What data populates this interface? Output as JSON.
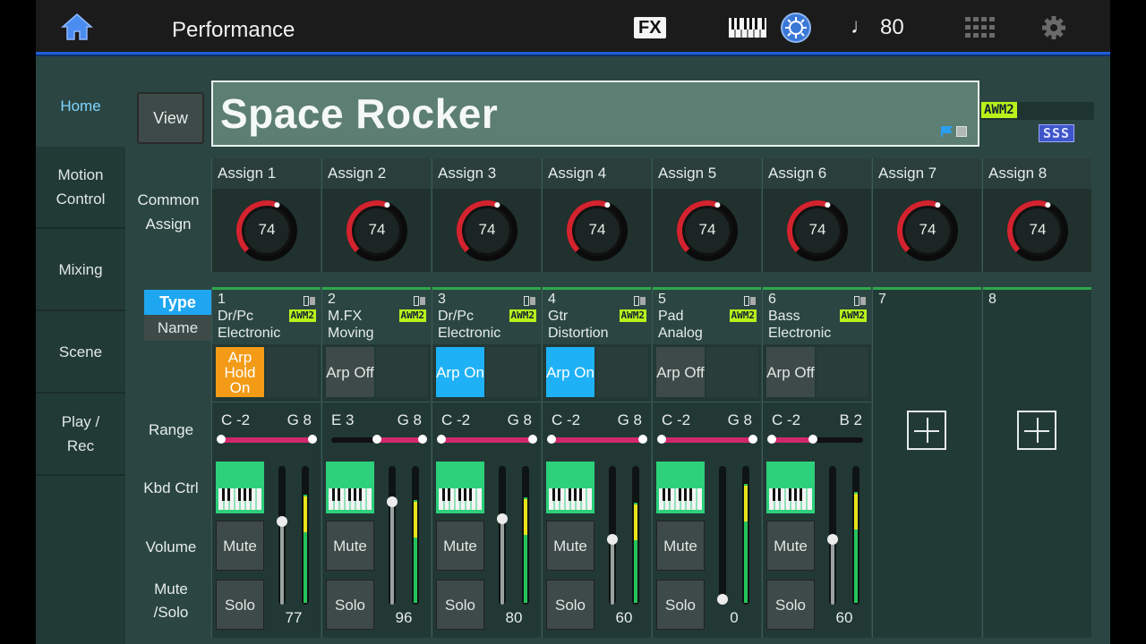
{
  "topbar": {
    "title": "Performance",
    "fx_label": "FX",
    "tempo": "80",
    "tempo_icon": "quarter-note-icon"
  },
  "sidebar": [
    {
      "label": "Home",
      "active": true
    },
    {
      "label": "Motion Control",
      "active": false
    },
    {
      "label": "Mixing",
      "active": false
    },
    {
      "label": "Scene",
      "active": false
    },
    {
      "label": "Play / Rec",
      "active": false
    }
  ],
  "header": {
    "view_label": "View",
    "performance_name": "Space Rocker",
    "awm2": "AWM2",
    "sss": "SSS"
  },
  "common_assign": {
    "label": "Common Assign",
    "knobs": [
      {
        "label": "Assign 1",
        "value": "74",
        "level": 0.58
      },
      {
        "label": "Assign 2",
        "value": "74",
        "level": 0.58
      },
      {
        "label": "Assign 3",
        "value": "74",
        "level": 0.58
      },
      {
        "label": "Assign 4",
        "value": "74",
        "level": 0.58
      },
      {
        "label": "Assign 5",
        "value": "74",
        "level": 0.58
      },
      {
        "label": "Assign 6",
        "value": "74",
        "level": 0.58
      },
      {
        "label": "Assign 7",
        "value": "74",
        "level": 0.58
      },
      {
        "label": "Assign 8",
        "value": "74",
        "level": 0.58
      }
    ]
  },
  "row_labels": {
    "type": "Type",
    "name": "Name",
    "range": "Range",
    "kbd_ctrl": "Kbd Ctrl",
    "volume": "Volume",
    "mute_solo": "Mute /Solo"
  },
  "parts": [
    {
      "num": "1",
      "category": "Dr/Pc",
      "sub": "Electronic",
      "engine": "AWM2",
      "arp": "Arp Hold On",
      "arp_state": "hold",
      "range_lo": "C -2",
      "range_hi": "G 8",
      "range_start": 0.0,
      "range_end": 1.0,
      "mute": "Mute",
      "solo": "Solo",
      "volume": "77",
      "fader_level": 0.61,
      "meter_level": 0.8
    },
    {
      "num": "2",
      "category": "M.FX",
      "sub": "Moving",
      "engine": "AWM2",
      "arp": "Arp Off",
      "arp_state": "off",
      "range_lo": "E 3",
      "range_hi": "G 8",
      "range_start": 0.5,
      "range_end": 1.0,
      "mute": "Mute",
      "solo": "Solo",
      "volume": "96",
      "fader_level": 0.76,
      "meter_level": 0.76
    },
    {
      "num": "3",
      "category": "Dr/Pc",
      "sub": "Electronic",
      "engine": "AWM2",
      "arp": "Arp On",
      "arp_state": "on",
      "range_lo": "C -2",
      "range_hi": "G 8",
      "range_start": 0.0,
      "range_end": 1.0,
      "mute": "Mute",
      "solo": "Solo",
      "volume": "80",
      "fader_level": 0.63,
      "meter_level": 0.78
    },
    {
      "num": "4",
      "category": "Gtr",
      "sub": "Distortion",
      "engine": "AWM2",
      "arp": "Arp On",
      "arp_state": "on",
      "range_lo": "C -2",
      "range_hi": "G 8",
      "range_start": 0.0,
      "range_end": 1.0,
      "mute": "Mute",
      "solo": "Solo",
      "volume": "60",
      "fader_level": 0.47,
      "meter_level": 0.74
    },
    {
      "num": "5",
      "category": "Pad",
      "sub": "Analog",
      "engine": "AWM2",
      "arp": "Arp Off",
      "arp_state": "off",
      "range_lo": "C -2",
      "range_hi": "G 8",
      "range_start": 0.0,
      "range_end": 1.0,
      "mute": "Mute",
      "solo": "Solo",
      "volume": "0",
      "fader_level": 0.0,
      "meter_level": 0.88
    },
    {
      "num": "6",
      "category": "Bass",
      "sub": "Electronic",
      "engine": "AWM2",
      "arp": "Arp Off",
      "arp_state": "off",
      "range_lo": "C -2",
      "range_hi": "B 2",
      "range_start": 0.0,
      "range_end": 0.45,
      "mute": "Mute",
      "solo": "Solo",
      "volume": "60",
      "fader_level": 0.47,
      "meter_level": 0.82
    }
  ],
  "empty_parts": [
    {
      "num": "7"
    },
    {
      "num": "8"
    }
  ]
}
